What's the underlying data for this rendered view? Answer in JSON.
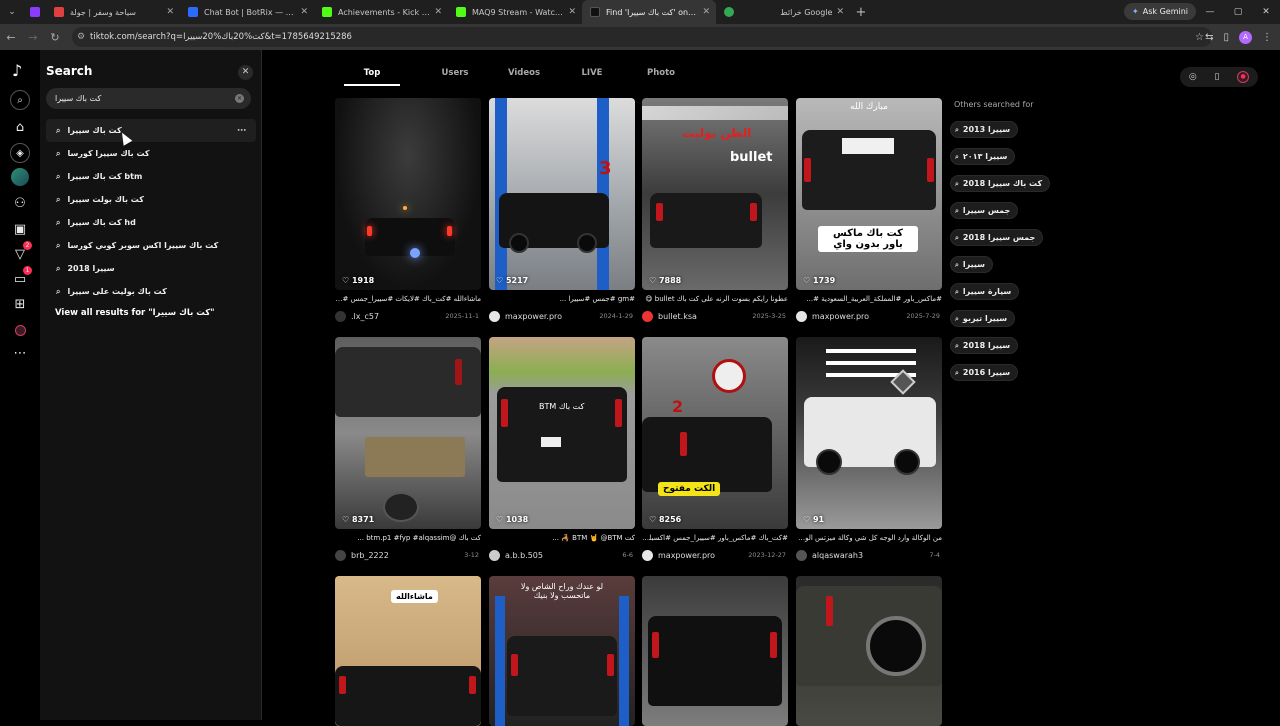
{
  "browser": {
    "tabs": [
      {
        "title": "سياحة وسفر | جولة",
        "fav": "#e04040"
      },
      {
        "title": "Chat Bot | BotRix — Cloud Stre...",
        "fav": "#2b6cff"
      },
      {
        "title": "Achievements - Kick Dashboard",
        "fav": "#53fc18"
      },
      {
        "title": "MAQ9 Stream - Watch Live on ...",
        "fav": "#53fc18"
      },
      {
        "title": "Find 'كت باك سييرا' on TikTok | T...",
        "fav": "#111111"
      },
      {
        "title": "خرائط Google",
        "fav": "#34a853"
      }
    ],
    "gemini_label": "Ask Gemini",
    "url": "tiktok.com/search?q=كت%20باك%20سييرا&t=1785649215286",
    "profile_initial": "A"
  },
  "panel": {
    "title": "Search",
    "query": "كت باك سييرا",
    "suggestions": [
      "كت باك سييرا",
      "كت باك سييرا كورسا",
      "كت باك سييرا btm",
      "كت باك بولت سييرا",
      "كت باك سييرا hd",
      "كت باك سييرا اكس سوبر كوبي كورسا",
      "سييرا 2018",
      "كت باك بوليت على سييرا"
    ],
    "view_all": "View all results for \"كت باك سييرا\""
  },
  "main": {
    "tabs": [
      "Top",
      "Users",
      "Videos",
      "LIVE",
      "Photo"
    ],
    "videos": [
      {
        "likes": "1918",
        "caption": "ماشاءالله #كت_باك #لايكات #سييرا_جمس #كت_باك",
        "user": ".lx_c57",
        "date": "2025-11-1"
      },
      {
        "likes": "5217",
        "caption": "#gm #جمس #سييرا ...",
        "user": "maxpower.pro",
        "date": "2024-1-29"
      },
      {
        "likes": "7888",
        "caption": "عطونا رايكم بسوت الرنه على كت باك bullet 😋",
        "user": "bullet.ksa",
        "date": "2025-3-25"
      },
      {
        "likes": "1739",
        "caption": "#ماكس_باور #المملكة_العربية_السعودية #...",
        "user": "maxpower.pro",
        "date": "2025-7-29"
      },
      {
        "likes": "8371",
        "caption": "كت باك @btm.p1 #fyp #alqassim ...",
        "user": "brb_2222",
        "date": "3-12"
      },
      {
        "likes": "1038",
        "caption": "كت BTM 🤘 @BTM 🦂 ...",
        "user": "a.b.b.505",
        "date": "6-6"
      },
      {
        "likes": "8256",
        "caption": "#كت_باك #ماكس_باور #سييرا_جمس #اكسبلور ...",
        "user": "maxpower.pro",
        "date": "2023-12-27"
      },
      {
        "likes": "91",
        "caption": "من الوكالة وارد الوجه كل شي وكالة ميزتس الوكالة...",
        "user": "alqaswarah3",
        "date": "7-4"
      }
    ],
    "overlays": {
      "v3_title": "الطن بوليت",
      "v3_brand": "bullet",
      "v4_top": "مبارك الله",
      "v4_text": "كت باك ماكس باور بدون واي",
      "v7_text": "الكت مفتوح",
      "v9_text": "ماشاءالله",
      "v10_text": "لو عندك وراح الشاص ولا ماتحسب ولا بنيك"
    }
  },
  "others": {
    "heading": "Others searched for",
    "items": [
      "سييرا 2013",
      "سييرا ٢٠١٣",
      "كت باك سييرا 2018",
      "جمس سييرا",
      "جمس سييرا 2018",
      "سييرا",
      "سيارة سييرا",
      "سييرا تيربو",
      "سييرا 2018",
      "سييرا 2016"
    ]
  },
  "colors": {
    "accent": "#fe2c55",
    "bg": "#000000",
    "panel": "#121212"
  },
  "icons": {
    "logo": "tiktok-logo",
    "search": "search-icon",
    "home": "home-icon",
    "explore": "compass-icon",
    "following": "people-icon",
    "live": "live-icon",
    "messages": "message-icon",
    "upload": "plus-square-icon",
    "more": "more-icon"
  }
}
